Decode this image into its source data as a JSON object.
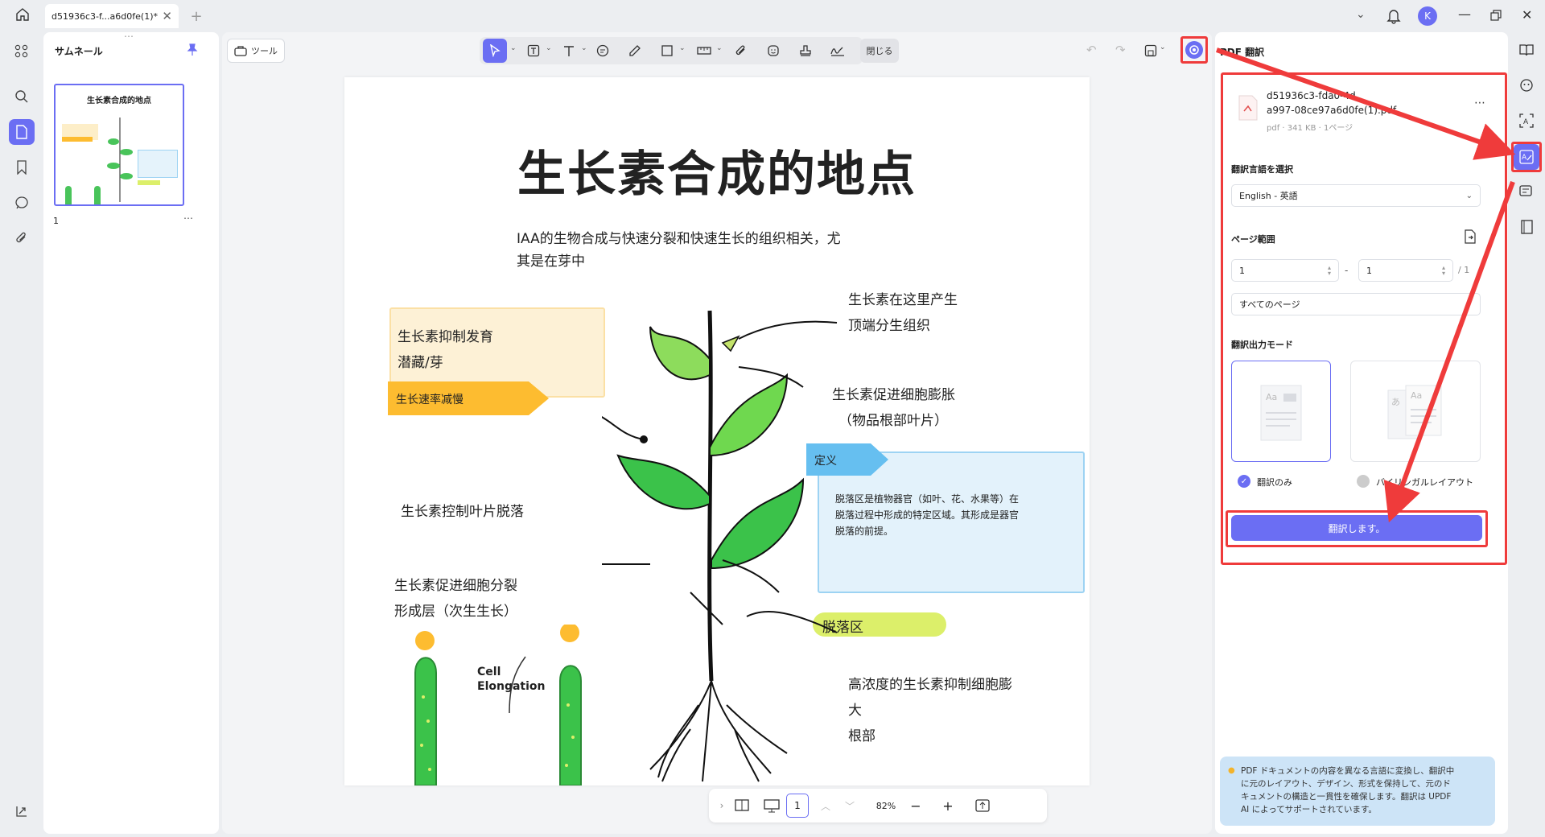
{
  "tab": {
    "title": "d51936c3-f...a6d0fe(1)*"
  },
  "thumbnails": {
    "title": "サムネール",
    "page_number": "1",
    "thumb_title": "生长素合成的地点"
  },
  "toolbar": {
    "tools_label": "ツール",
    "close_label": "閉じる"
  },
  "document": {
    "title": "生长素合成的地点",
    "intro": [
      "IAA的生物合成与快速分裂和快速生长的组织相关，尤",
      "其是在芽中"
    ],
    "box1": {
      "line1": "生长素抑制发育",
      "line2": "潜藏/芽",
      "tag": "生长速率减慢"
    },
    "label_leaf_drop": "生长素控制叶片脱落",
    "label_division": [
      "生长素促进细胞分裂",
      "形成层（次生生长）"
    ],
    "cell_elongation": [
      "Cell",
      "Elongation"
    ],
    "label_top": [
      "生长素在这里产生",
      "顶端分生组织"
    ],
    "label_expand": [
      "生长素促进细胞膨胀",
      "（物品根部叶片）"
    ],
    "definition": {
      "tag": "定义",
      "text": [
        "脱落区是植物器官（如叶、花、水果等）在",
        "脱落过程中形成的特定区域。其形成是器官",
        "脱落的前提。"
      ]
    },
    "abscission_tag": "脱落区",
    "label_root": [
      "高浓度的生长素抑制细胞膨",
      "大",
      "根部"
    ]
  },
  "panel": {
    "title": "PDF 翻訳",
    "file_name_1": "d51936c3-fda0-4d",
    "file_name_2": "a997-08ce97a6d0fe(1).pdf",
    "file_meta": "pdf · 341 KB · 1ページ",
    "lang_label": "翻訳言語を選択",
    "lang_value": "English - 英語",
    "range_label": "ページ範囲",
    "range_from": "1",
    "range_to": "1",
    "range_sep": "-",
    "range_total": "/ 1",
    "all_pages": "すべてのページ",
    "mode_label": "翻訳出力モード",
    "mode_translate_only": "翻訳のみ",
    "mode_bilingual": "バイリンガルレイアウト",
    "translate_button": "翻訳します。",
    "info_text": [
      "PDF ドキュメントの内容を異なる言語に変換し、翻訳中",
      "に元のレイアウト、デザイン、形式を保持して、元のド",
      "キュメントの構造と一貫性を確保します。翻訳は UPDF",
      "AI によってサポートされています。"
    ]
  },
  "bottom": {
    "page": "1",
    "zoom": "82%"
  },
  "user_initial": "K",
  "colors": {
    "accent": "#6b6ef3",
    "annotation_red": "#ef3b3b",
    "yellow_tag": "#fdbc30",
    "blue_tag": "#66bff0",
    "lime_tag": "#dcef6a"
  }
}
